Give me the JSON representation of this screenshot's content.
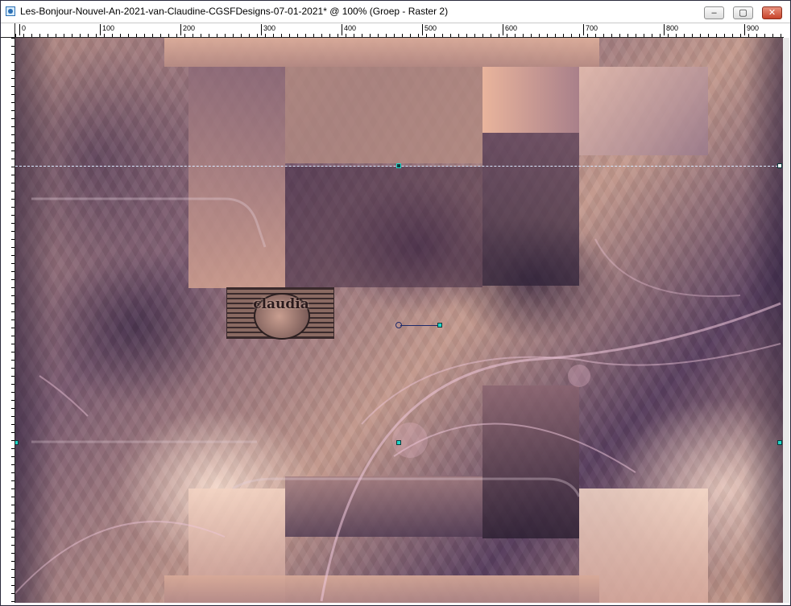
{
  "window": {
    "title": "Les-Bonjour-Nouvel-An-2021-van-Claudine-CGSFDesigns-07-01-2021* @ 100% (Groep - Raster 2)",
    "buttons": {
      "minimize_icon": "minimize-icon",
      "maximize_icon": "maximize-icon",
      "close_icon": "close-icon"
    }
  },
  "ruler": {
    "ticks": [
      "0",
      "100",
      "200",
      "300",
      "400",
      "500",
      "600",
      "700",
      "800",
      "900"
    ]
  },
  "canvas": {
    "watermark_text": "claudia"
  },
  "colors": {
    "selection_handle": "#1fd6c8",
    "close_button": "#c7432a",
    "canvas_tone": "#b58c85"
  }
}
